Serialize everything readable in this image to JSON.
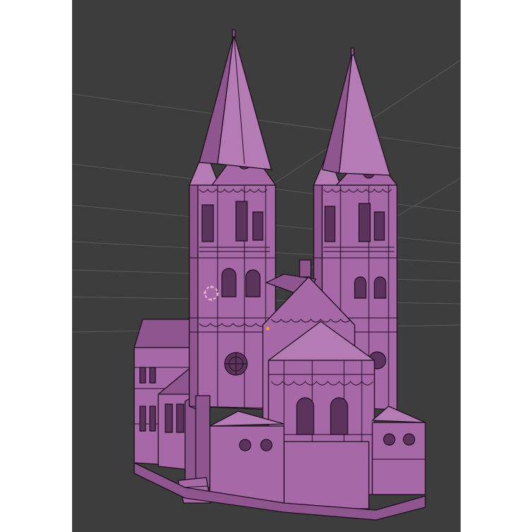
{
  "viewport": {
    "background": "#3d3d3d",
    "mesh_color": "#a668a6",
    "wire_color": "#1d0f1d",
    "grid_color": "#5a5a5a",
    "side_panel_color": "#ffffff"
  },
  "cursor": {
    "icon": "3d-cursor-icon",
    "color": "#e8c0c0"
  },
  "origin_marker": {
    "icon": "object-origin-dot",
    "color": "#f0a030"
  }
}
